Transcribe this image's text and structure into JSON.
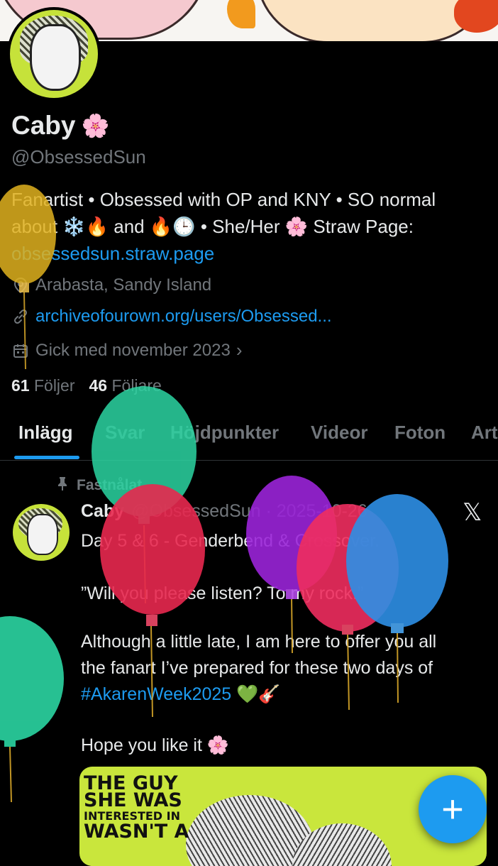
{
  "profile": {
    "name": "Caby",
    "name_emoji": "🌸",
    "handle": "@ObsessedSun",
    "bio_line1": "Fanartist • Obsessed with OP and KNY • SO normal",
    "bio_line2": "about ❄️🔥 and 🔥🕒 • She/Her 🌸 Straw Page:",
    "bio_link": "obsessedsun.straw.page",
    "location": "Arabasta, Sandy Island",
    "website": "archiveofourown.org/users/Obsessed...",
    "joined": "Gick med november 2023",
    "following_count": "61",
    "following_label": "Följer",
    "followers_count": "46",
    "followers_label": "Följare"
  },
  "tabs": [
    "Inlägg",
    "Svar",
    "Höjdpunkter",
    "Videor",
    "Foton",
    "Art"
  ],
  "post": {
    "pinned_label": "Fastnålat",
    "author": "Caby",
    "handle_date": "@ObsessedSun · 2025-10-26",
    "line1": "Day 5 & 6 - Genderbend & Crossover.",
    "quote": "”Will you please listen? To my rock.”",
    "body_line1": "Although a little late, I am here to offer you all",
    "body_line2": "the fanart I’ve prepared for these two days of",
    "hashtag": "#AkarenWeek2025",
    "hashtag_emoji": " 💚🎸",
    "closing": "Hope you like it 🌸",
    "media_title_1": "THE GUY",
    "media_title_2": "SHE WAS",
    "media_title_3": "INTERESTED IN",
    "media_title_4": "WASN'T A"
  },
  "fab_label": "+",
  "colors": {
    "background": "#000000",
    "text": "#e7e9ea",
    "muted": "#71767b",
    "accent": "#1d9bf0",
    "avatar_bg": "#c6e23a"
  },
  "icons": {
    "location": "location-pin-icon",
    "link": "link-icon",
    "calendar": "calendar-icon",
    "pin": "pin-icon",
    "x_logo": "x-logo-icon",
    "compose": "plus-icon"
  }
}
